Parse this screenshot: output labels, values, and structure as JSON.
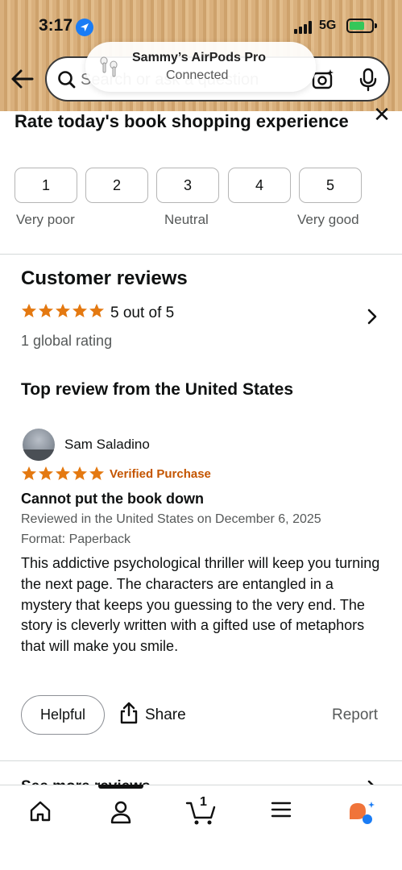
{
  "status_bar": {
    "time": "3:17",
    "network": "5G"
  },
  "search": {
    "placeholder": "Search or ask a question"
  },
  "airpods_banner": {
    "device": "Sammy’s AirPods Pro",
    "status": "Connected"
  },
  "survey": {
    "title": "Rate today's book shopping experience",
    "options": [
      "1",
      "2",
      "3",
      "4",
      "5"
    ],
    "labels": {
      "low": "Very poor",
      "mid": "Neutral",
      "high": "Very good"
    }
  },
  "customer_reviews": {
    "title": "Customer reviews",
    "rating": 5,
    "rating_text": "5 out of 5",
    "global_rating": "1 global rating",
    "star_color": "#e47911"
  },
  "top_review": {
    "section_title": "Top review from the United States",
    "reviewer": "Sam Saladino",
    "stars": 5,
    "verified": "Verified Purchase",
    "title": "Cannot put the book down",
    "date_line": "Reviewed in the United States on December 6, 2025",
    "format_line": "Format: Paperback",
    "body": "This addictive psychological thriller will keep you turning the next page. The characters are entangled in a mystery that keeps you guessing to the very end. The story is cleverly written with a gifted use of metaphors that will make you smile.",
    "helpful_label": "Helpful",
    "share_label": "Share",
    "report_label": "Report"
  },
  "see_more": {
    "label": "See more reviews"
  },
  "bottom_nav": {
    "items": [
      "home-icon",
      "account-icon",
      "cart-icon",
      "menu-icon",
      "rufus-icon"
    ],
    "cart_count": "1"
  }
}
